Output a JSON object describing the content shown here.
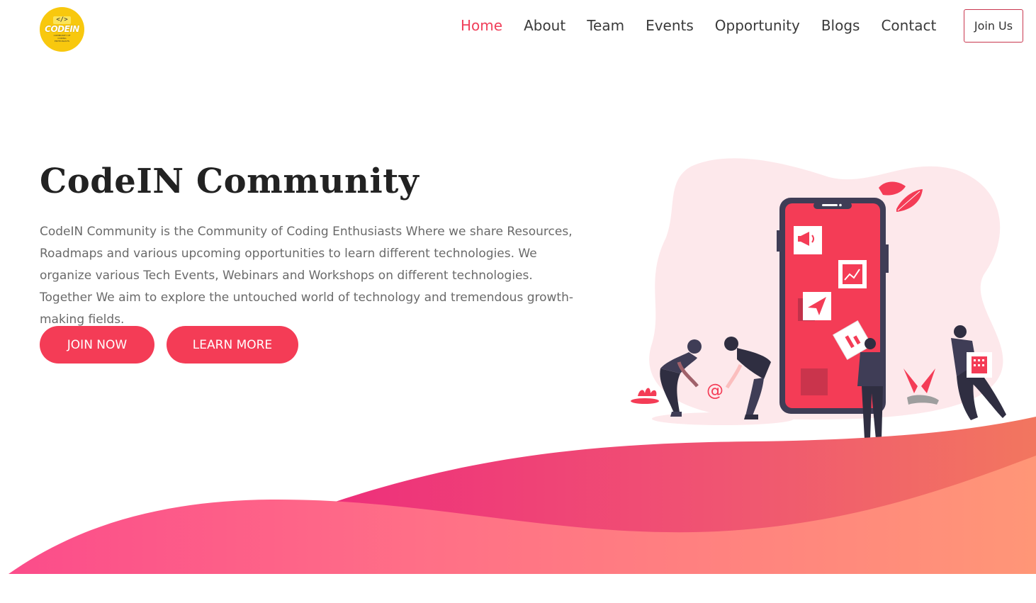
{
  "brand": {
    "logo_tag": "</>",
    "logo_word": "CODEIN",
    "logo_sub": "COMMUNITY OF CODING ENTHUSIASTS",
    "accent": "#f43c56",
    "logo_bg": "#f8c80e"
  },
  "nav": {
    "items": [
      {
        "label": "Home",
        "active": true
      },
      {
        "label": "About"
      },
      {
        "label": "Team"
      },
      {
        "label": "Events"
      },
      {
        "label": "Opportunity"
      },
      {
        "label": "Blogs"
      },
      {
        "label": "Contact"
      }
    ],
    "join_label": "Join Us"
  },
  "hero": {
    "title": "CodeIN Community",
    "description": "CodeIN Community is the Community of Coding Enthusiasts Where we share Resources, Roadmaps and various upcoming opportunities to learn different technologies. We organize various Tech Events, Webinars and Workshops on different technologies. Together We aim to explore the untouched world of technology and tremendous growth-making fields.",
    "join_now_label": "JOIN NOW",
    "learn_more_label": "LEARN MORE",
    "illustration_icons": [
      "megaphone-icon",
      "chart-icon",
      "paper-plane-icon",
      "at-sign-icon",
      "building-icon",
      "leaf-icon"
    ],
    "at_symbol": "@"
  }
}
